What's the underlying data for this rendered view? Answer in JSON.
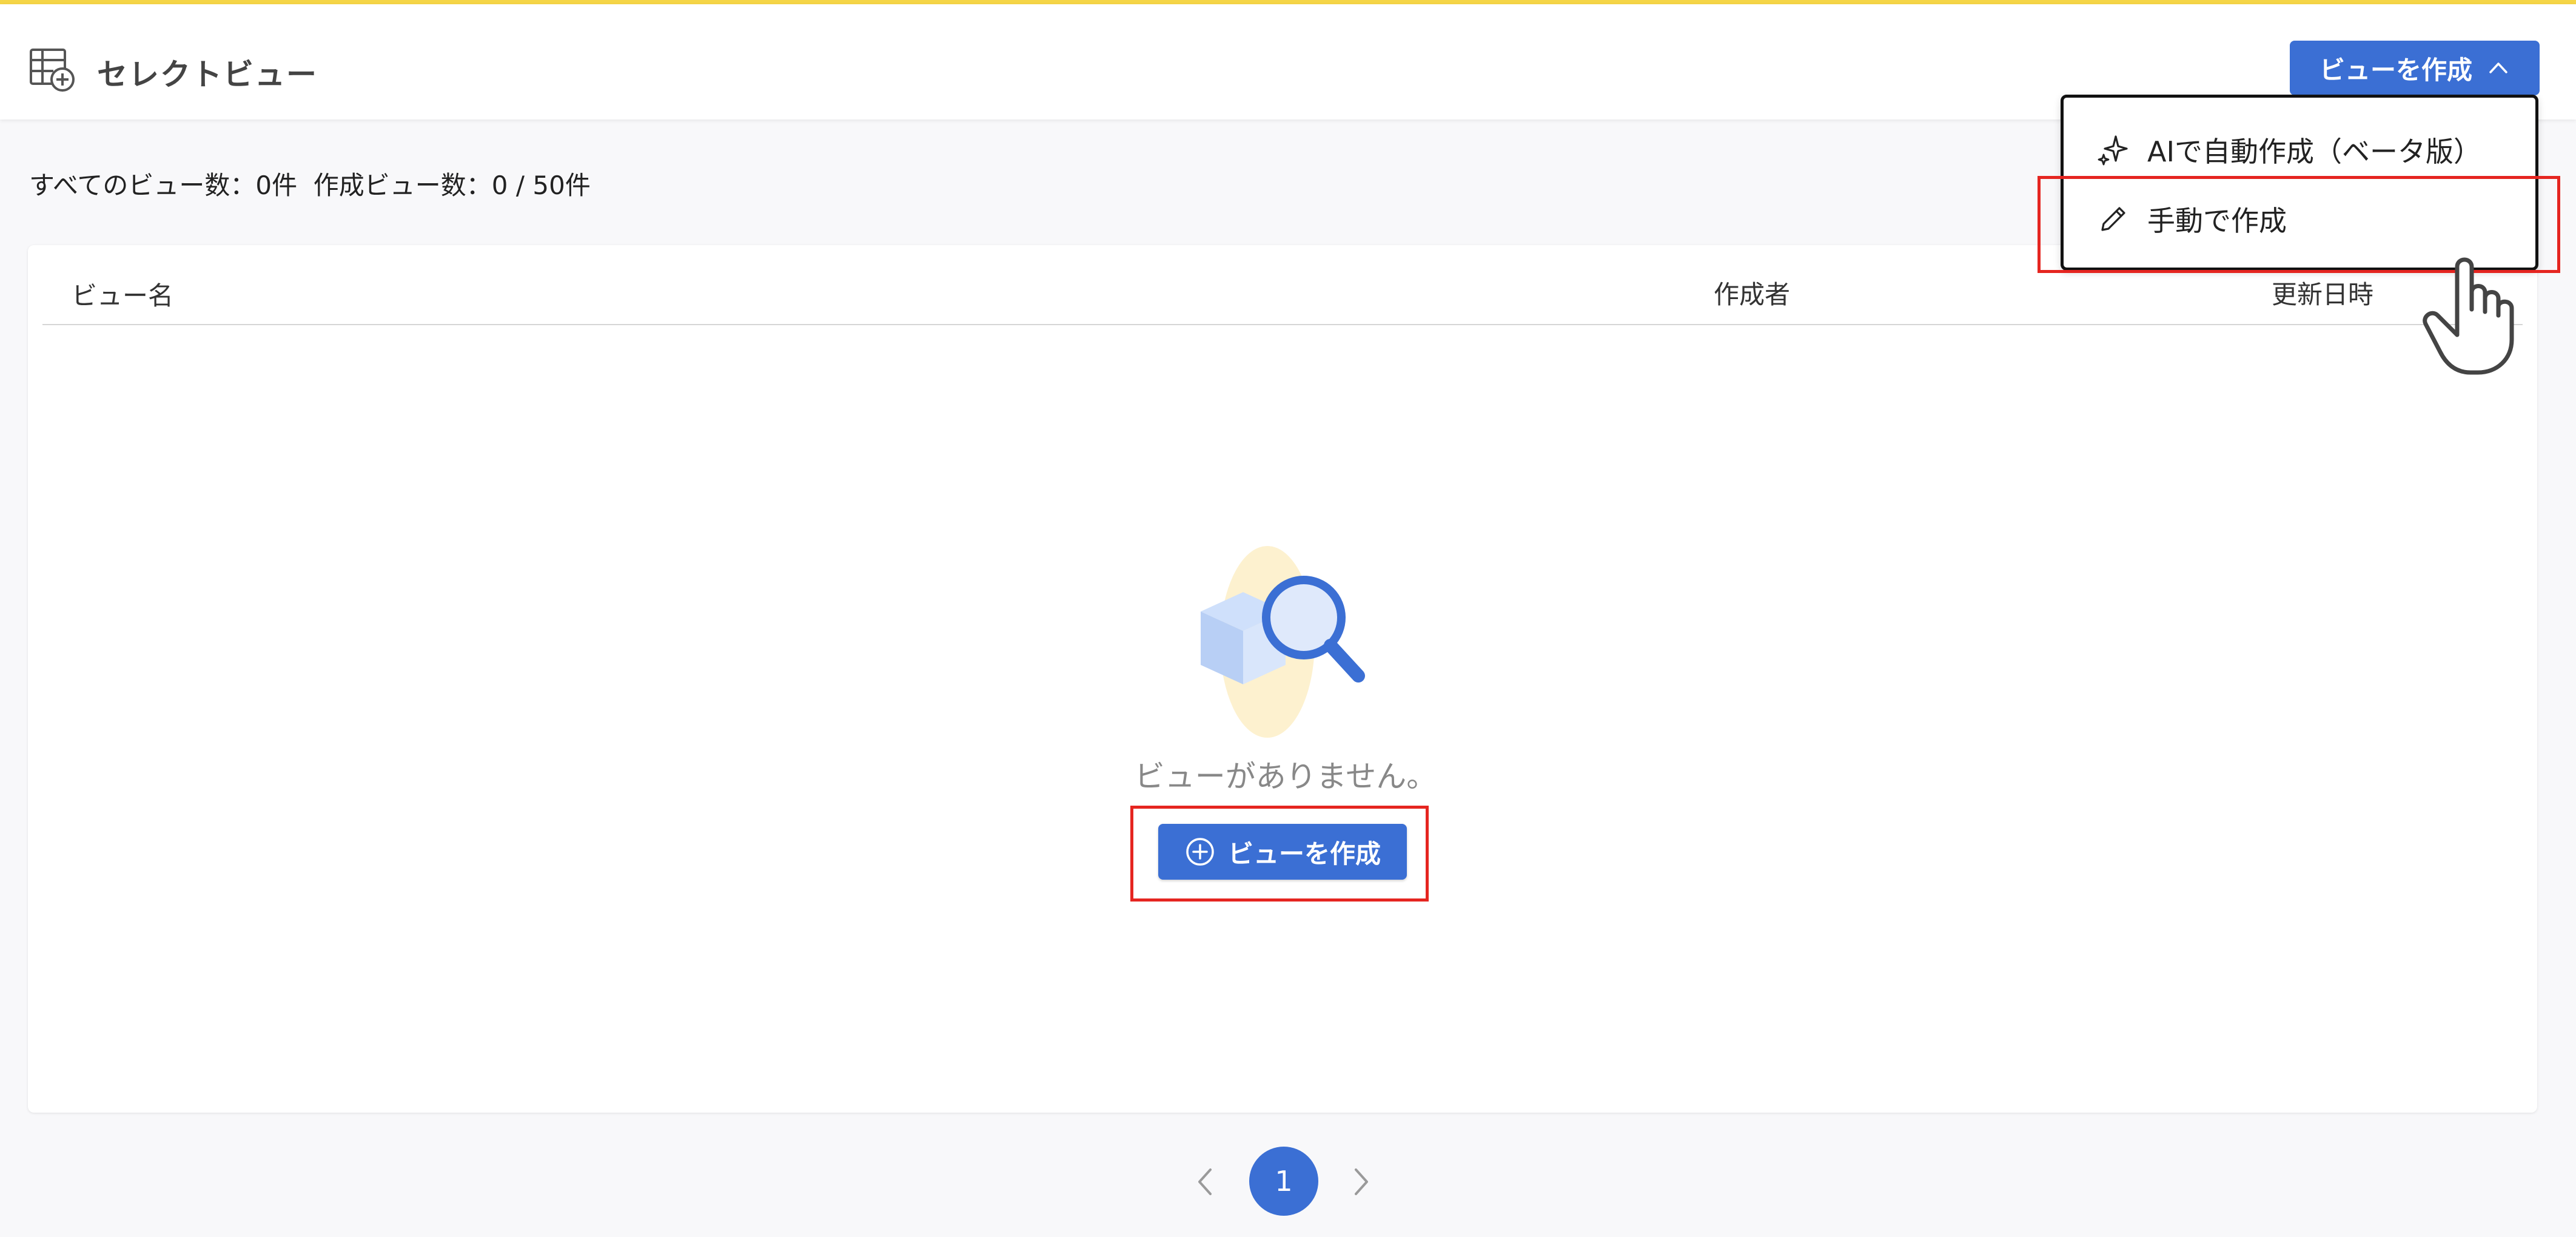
{
  "header": {
    "title": "セレクトビュー",
    "create_button_label": "ビューを作成"
  },
  "summary": {
    "text": "すべてのビュー数：0件  作成ビュー数：0 / 50件"
  },
  "table": {
    "columns": [
      "ビュー名",
      "作成者",
      "更新日時"
    ]
  },
  "empty_state": {
    "message": "ビューがありません。",
    "button_label": "ビューを作成"
  },
  "dropdown": {
    "items": [
      {
        "label": "AIで自動作成（ベータ版）",
        "icon": "sparkle-icon"
      },
      {
        "label": "手動で作成",
        "icon": "pencil-icon"
      }
    ]
  },
  "pagination": {
    "current_page": "1"
  },
  "colors": {
    "accent": "#3b6fd4",
    "top_bar": "#f5d547",
    "highlight": "#e52520"
  }
}
